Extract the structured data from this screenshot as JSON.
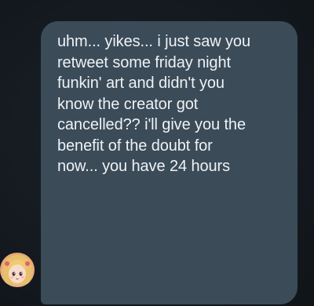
{
  "message": {
    "lines": [
      "uhm... yikes... i just saw you",
      "retweet some friday night",
      "funkin' art and didn't you",
      "know the creator got",
      "cancelled?? i'll give you the",
      "benefit of the doubt for",
      "now... you have 24 hours"
    ]
  },
  "colors": {
    "background": "#151b21",
    "bubble": "#3b4b58",
    "text": "#eef2f5"
  },
  "avatar": {
    "icon": "anime-character-avatar-icon"
  }
}
